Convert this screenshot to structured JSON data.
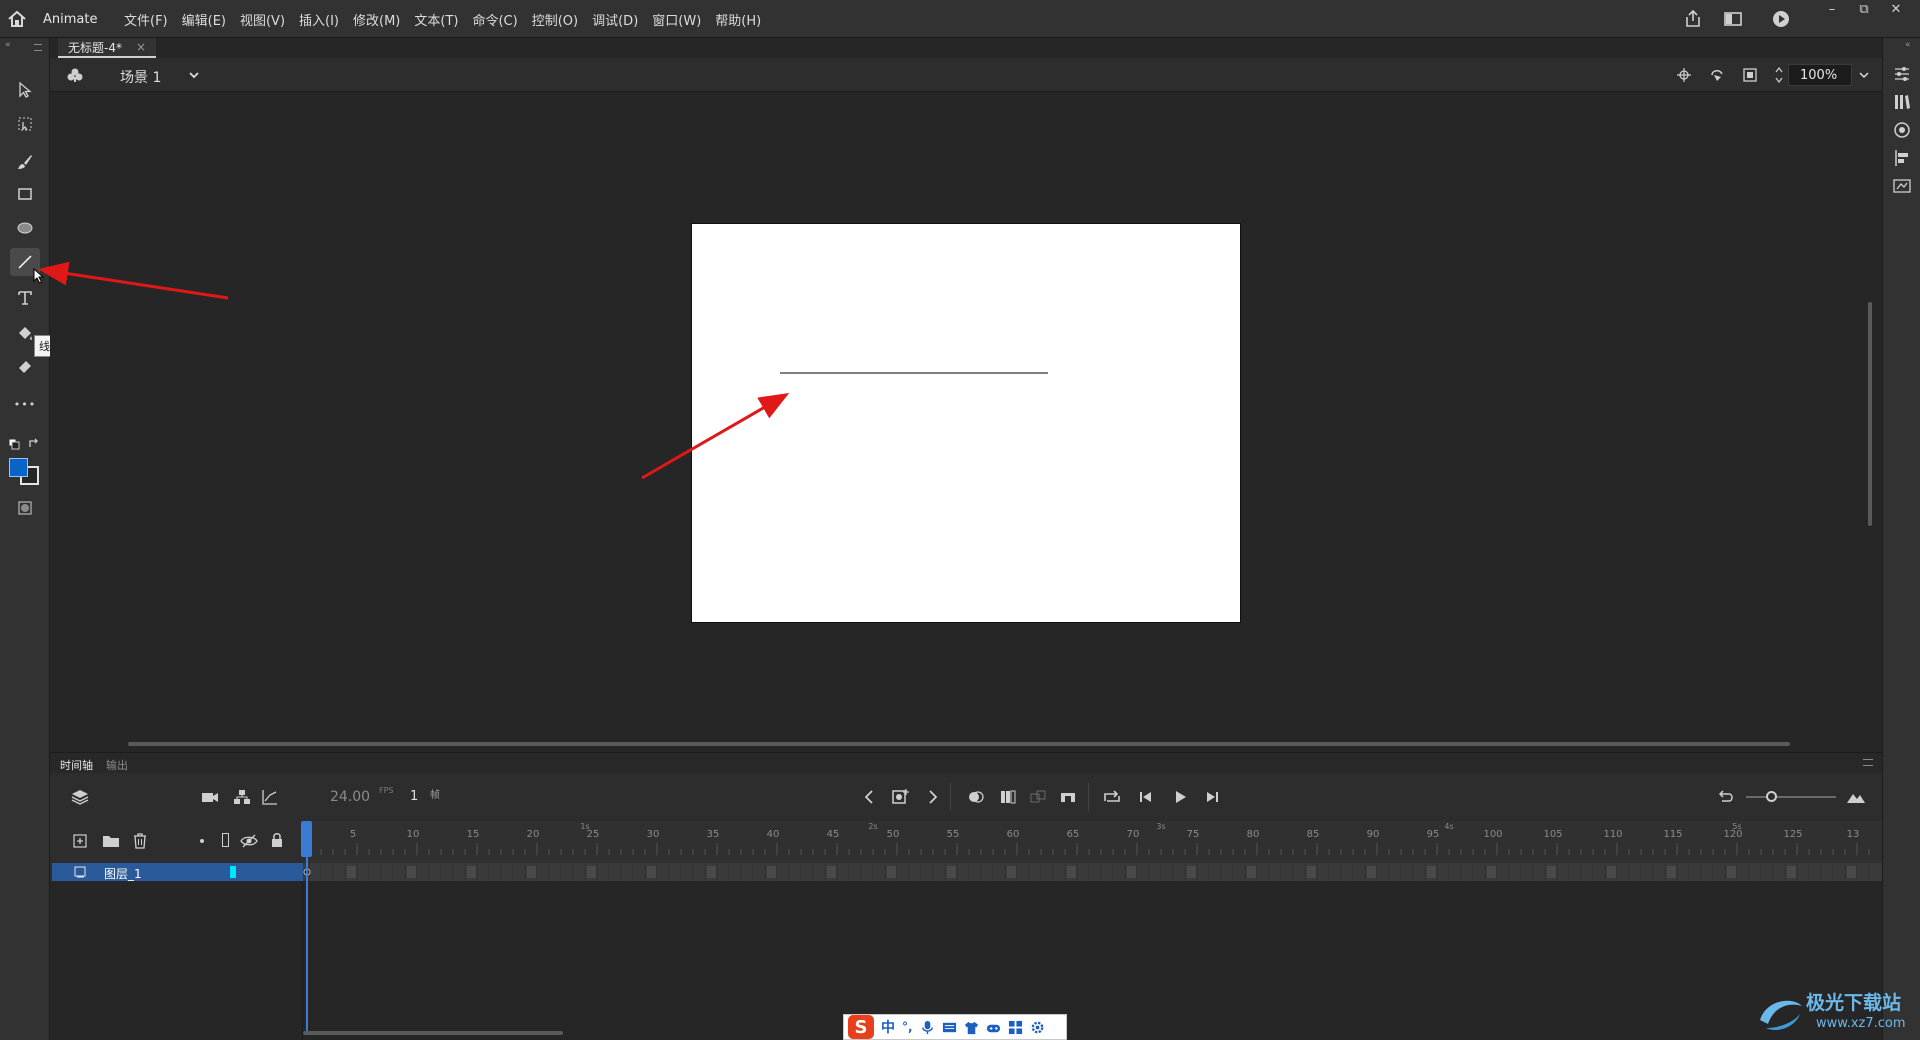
{
  "app": {
    "title": "Animate",
    "menus": [
      "文件(F)",
      "编辑(E)",
      "视图(V)",
      "插入(I)",
      "修改(M)",
      "文本(T)",
      "命令(C)",
      "控制(O)",
      "调试(D)",
      "窗口(W)",
      "帮助(H)"
    ],
    "window_controls": {
      "minimize": "–",
      "restore": "⧉",
      "close": "✕"
    }
  },
  "document": {
    "tab_title": "无标题-4*",
    "tab_close": "×"
  },
  "scene": {
    "label": "场景 1",
    "zoom": "100%"
  },
  "tools": {
    "tooltip": "线条工具 (N)",
    "active": "line-tool",
    "more": "•••"
  },
  "colors": {
    "fill": "#0a64c8",
    "accent": "#3a7bd5",
    "layer_selected": "#2a5a9a",
    "arrow": "#e01818",
    "stage": "#ffffff"
  },
  "timeline": {
    "tab_timeline": "时间轴",
    "tab_output": "输出",
    "fps": "24.00",
    "fps_unit": "FPS",
    "current_frame": "1",
    "frame_unit": "帧",
    "layer_name": "图层_1",
    "ruler_numbers": [
      "5",
      "10",
      "15",
      "20",
      "25",
      "30",
      "35",
      "40",
      "45",
      "50",
      "55",
      "60",
      "65",
      "70",
      "75",
      "80",
      "85",
      "90",
      "95",
      "100",
      "105",
      "110",
      "115",
      "120",
      "125",
      "13"
    ],
    "second_marks": [
      "1s",
      "2s",
      "3s",
      "4s",
      "5s"
    ]
  },
  "ime": {
    "logo": "S",
    "lang": "中",
    "punct": "°,"
  },
  "watermark": {
    "line1": "极光下载站",
    "line2": "www.xz7.com"
  }
}
